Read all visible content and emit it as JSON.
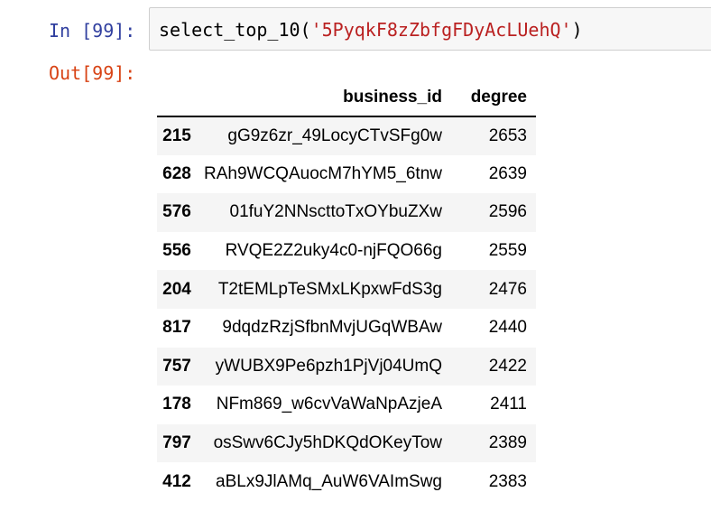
{
  "cell": {
    "in_prompt": "In [99]:",
    "out_prompt": "Out[99]:",
    "code": {
      "func": "select_top_10",
      "open_paren": "(",
      "arg": "'5PyqkF8zZbfgFDyAcLUehQ'",
      "close_paren": ")"
    }
  },
  "table": {
    "columns": {
      "index": "",
      "business_id": "business_id",
      "degree": "degree"
    },
    "rows": [
      {
        "index": "215",
        "business_id": "gG9z6zr_49LocyCTvSFg0w",
        "degree": "2653"
      },
      {
        "index": "628",
        "business_id": "RAh9WCQAuocM7hYM5_6tnw",
        "degree": "2639"
      },
      {
        "index": "576",
        "business_id": "01fuY2NNscttoTxOYbuZXw",
        "degree": "2596"
      },
      {
        "index": "556",
        "business_id": "RVQE2Z2uky4c0-njFQO66g",
        "degree": "2559"
      },
      {
        "index": "204",
        "business_id": "T2tEMLpTeSMxLKpxwFdS3g",
        "degree": "2476"
      },
      {
        "index": "817",
        "business_id": "9dqdzRzjSfbnMvjUGqWBAw",
        "degree": "2440"
      },
      {
        "index": "757",
        "business_id": "yWUBX9Pe6pzh1PjVj04UmQ",
        "degree": "2422"
      },
      {
        "index": "178",
        "business_id": "NFm869_w6cvVaWaNpAzjeA",
        "degree": "2411"
      },
      {
        "index": "797",
        "business_id": "osSwv6CJy5hDKQdOKeyTow",
        "degree": "2389"
      },
      {
        "index": "412",
        "business_id": "aBLx9JlAMq_AuW6VAImSwg",
        "degree": "2383"
      }
    ]
  },
  "colors": {
    "in_prompt": "#303f9f",
    "out_prompt": "#d84315",
    "string": "#ba2121",
    "input_bg": "#f7f7f7",
    "stripe": "#f5f5f5"
  }
}
